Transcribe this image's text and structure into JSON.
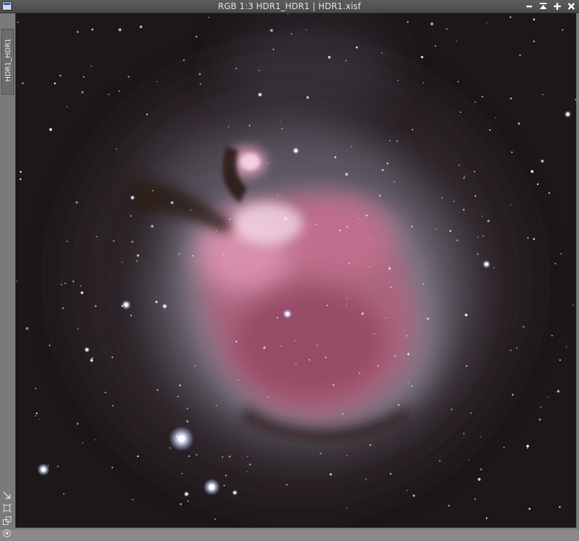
{
  "window": {
    "title": "RGB 1:3 HDR1_HDR1 | HDR1.xisf",
    "app_icon": "image-window-icon",
    "buttons": [
      {
        "name": "minimize-button",
        "icon": "minimize-icon"
      },
      {
        "name": "shade-button",
        "icon": "shade-icon"
      },
      {
        "name": "maximize-button",
        "icon": "maximize-icon"
      },
      {
        "name": "close-button",
        "icon": "close-icon"
      }
    ]
  },
  "sidebar": {
    "view_tab_label": "HDR1_HDR1",
    "tools": [
      {
        "name": "zoom-to-fit-button",
        "icon": "fit-arrow-icon"
      },
      {
        "name": "reset-view-button",
        "icon": "crosshair-icon"
      },
      {
        "name": "clone-view-button",
        "icon": "clone-icon"
      },
      {
        "name": "lock-view-button",
        "icon": "target-icon"
      }
    ]
  },
  "image": {
    "subject": "nebula-astrophotograph",
    "colors": {
      "background": "#1c1718",
      "nebula_core": "#d58fae",
      "nebula_outer": "#8f8494",
      "dust": "#3a2723"
    }
  }
}
